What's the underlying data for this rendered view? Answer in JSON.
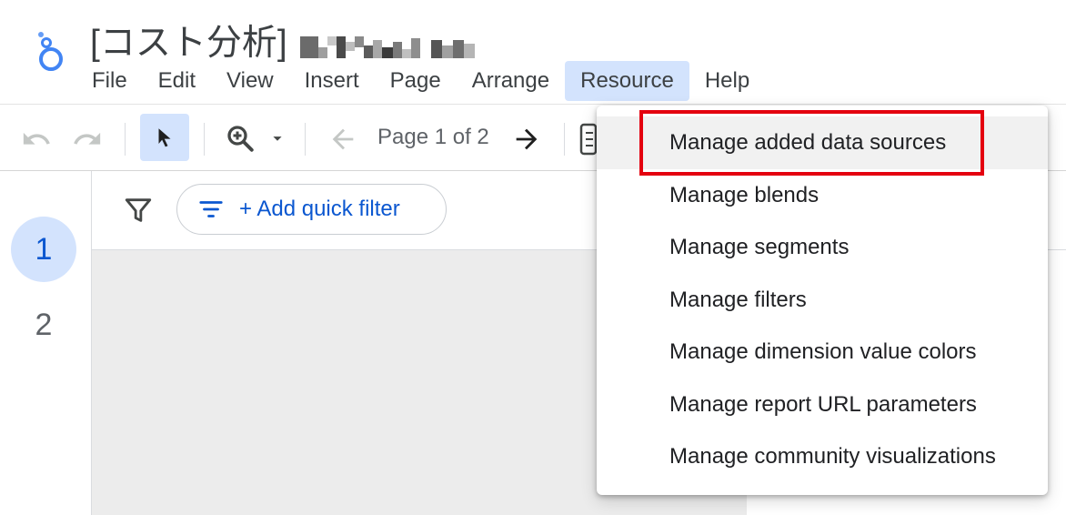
{
  "header": {
    "title": "[コスト分析]",
    "title_redacted": true
  },
  "menu": {
    "items": [
      {
        "label": "File"
      },
      {
        "label": "Edit"
      },
      {
        "label": "View"
      },
      {
        "label": "Insert"
      },
      {
        "label": "Page"
      },
      {
        "label": "Arrange"
      },
      {
        "label": "Resource",
        "active": true
      },
      {
        "label": "Help"
      }
    ]
  },
  "toolbar": {
    "page_label": "Page 1 of 2",
    "icons": [
      "undo-icon",
      "redo-icon",
      "pointer-icon",
      "zoom-icon",
      "chevron-down-icon",
      "arrow-back-icon",
      "arrow-forward-icon",
      "add-chart-icon"
    ]
  },
  "pages": {
    "items": [
      {
        "label": "1",
        "active": true
      },
      {
        "label": "2",
        "active": false
      }
    ]
  },
  "filter": {
    "quick_filter_label": "+ Add quick filter"
  },
  "resource_menu": {
    "items": [
      {
        "label": "Manage added data sources",
        "highlighted": true
      },
      {
        "label": "Manage blends"
      },
      {
        "label": "Manage segments"
      },
      {
        "label": "Manage filters"
      },
      {
        "label": "Manage dimension value colors"
      },
      {
        "label": "Manage report URL parameters"
      },
      {
        "label": "Manage community visualizations"
      }
    ]
  },
  "colors": {
    "accent_blue": "#0b57d0",
    "active_bg": "#d3e3fd",
    "highlight_red": "#e4000f",
    "canvas_gray": "#ececec"
  }
}
